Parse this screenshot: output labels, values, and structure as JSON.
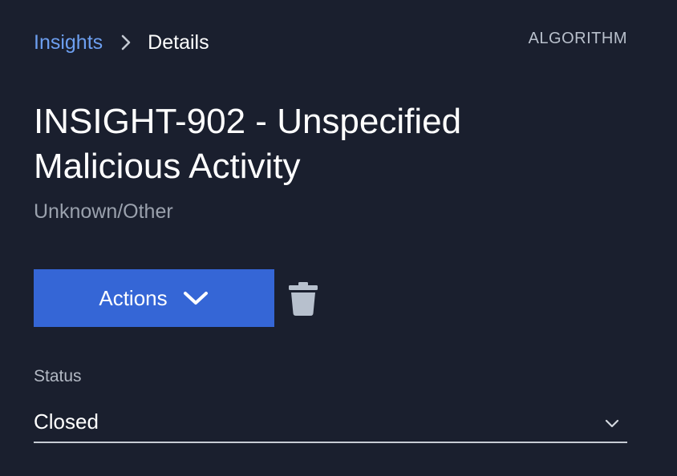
{
  "breadcrumb": {
    "parent": "Insights",
    "current": "Details"
  },
  "type_label": "ALGORITHM",
  "title": "INSIGHT-902 - Unspecified Malicious Activity",
  "subtitle": "Unknown/Other",
  "actions_button": {
    "label": "Actions",
    "icon": "chevron-down-icon"
  },
  "delete_icon": "trash-icon",
  "status_field": {
    "label": "Status",
    "value": "Closed",
    "icon": "chevron-down-icon"
  },
  "colors": {
    "background": "#1a1f2e",
    "link": "#6d9ff0",
    "primary_button": "#3566d6",
    "muted_text": "#9aa1ad",
    "icon": "#b7c0cd"
  }
}
